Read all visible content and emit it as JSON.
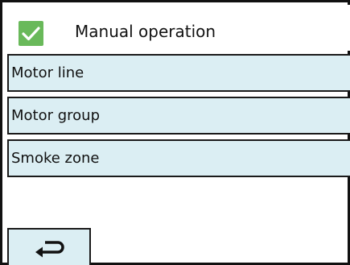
{
  "header": {
    "title": "Manual operation",
    "status_icon": "check-icon",
    "status_color": "#69b95a"
  },
  "menu": {
    "items": [
      {
        "label": "Motor line"
      },
      {
        "label": "Motor group"
      },
      {
        "label": "Smoke zone"
      }
    ],
    "item_background": "#dbeef3"
  },
  "footer": {
    "back_icon": "return-arrow-icon"
  }
}
